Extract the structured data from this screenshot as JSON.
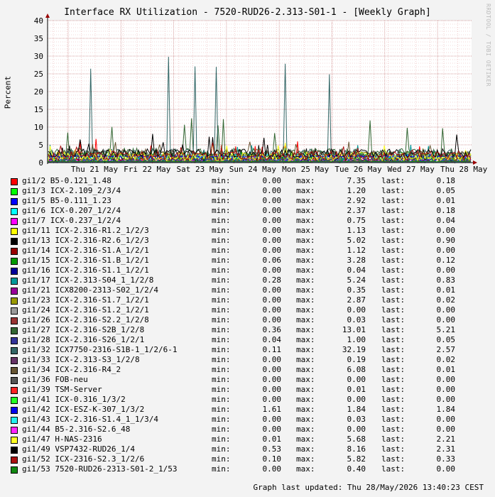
{
  "title": "Interface RX Utilization - 7520-RUD26-2.313-S01-1 - [Weekly Graph]",
  "watermark": "RRDTOOL / TOBI OETIKER",
  "footer": "Graph last updated: Thu 28/May/2026 13:40:23 CEST",
  "colors": {
    "background": "#f3f3f3",
    "plot_bg": "#ffffff",
    "grid_minor": "#e8b0b0",
    "grid_major": "#c88080",
    "axis": "#000000",
    "arrow": "#990000"
  },
  "chart_data": {
    "type": "line",
    "ylabel": "Percent",
    "ylim": [
      0,
      40
    ],
    "yticks": [
      "0",
      "5",
      "10",
      "15",
      "20",
      "25",
      "30",
      "35",
      "40"
    ],
    "xticks": [
      "Thu 21 May",
      "Fri 22 May",
      "Sat 23 May",
      "Sun 24 May",
      "Mon 25 May",
      "Tue 26 May",
      "Wed 27 May",
      "Thu 28 May"
    ],
    "grid": true,
    "legend_position": "bottom",
    "legend_labels": {
      "min": "min:",
      "max": "max:",
      "last": "last:"
    },
    "series": [
      {
        "name": "gi1/2 B5-0.121_1.48",
        "color": "#ff0000",
        "min": "0.00",
        "max": "7.35",
        "last": "0.18"
      },
      {
        "name": "gi1/3 ICX-2.109_2/3/4",
        "color": "#00ff00",
        "min": "0.00",
        "max": "1.20",
        "last": "0.05"
      },
      {
        "name": "gi1/5 B5-0.111_1.23",
        "color": "#0000ff",
        "min": "0.00",
        "max": "2.92",
        "last": "0.01"
      },
      {
        "name": "gi1/6 ICX-0.207_1/2/4",
        "color": "#00ffff",
        "min": "0.00",
        "max": "2.37",
        "last": "0.18"
      },
      {
        "name": "gi1/7 ICX-0.237_1/2/4",
        "color": "#ff00ff",
        "min": "0.00",
        "max": "0.75",
        "last": "0.04"
      },
      {
        "name": "gi1/11 ICX-2.316-R1.2_1/2/3",
        "color": "#ffff00",
        "min": "0.00",
        "max": "1.13",
        "last": "0.00"
      },
      {
        "name": "gi1/13 ICX-2.316-R2.6_1/2/3",
        "color": "#000000",
        "min": "0.00",
        "max": "5.02",
        "last": "0.90"
      },
      {
        "name": "gi1/14 ICX-2.316-S1.A_1/2/1",
        "color": "#990000",
        "min": "0.00",
        "max": "1.12",
        "last": "0.00"
      },
      {
        "name": "gi1/15 ICX-2.316-S1.B_1/2/1",
        "color": "#009900",
        "min": "0.06",
        "max": "3.28",
        "last": "0.12"
      },
      {
        "name": "gi1/16 ICX-2.316-S1.1_1/2/1",
        "color": "#000099",
        "min": "0.00",
        "max": "0.04",
        "last": "0.00"
      },
      {
        "name": "gi1/17 ICX-2.313-S04_1_1/2/8",
        "color": "#009999",
        "min": "0.28",
        "max": "5.24",
        "last": "0.83"
      },
      {
        "name": "gi1/21 ICX8200-2313-S02_1/2/4",
        "color": "#990099",
        "min": "0.00",
        "max": "0.35",
        "last": "0.01"
      },
      {
        "name": "gi1/23 ICX-2.316-S1.7_1/2/1",
        "color": "#999900",
        "min": "0.00",
        "max": "2.87",
        "last": "0.02"
      },
      {
        "name": "gi1/24 ICX-2.316-S1.2_1/2/1",
        "color": "#999999",
        "min": "0.00",
        "max": "0.00",
        "last": "0.00"
      },
      {
        "name": "gi1/26 ICX-2.316-S2.2_1/2/8",
        "color": "#993333",
        "min": "0.00",
        "max": "0.03",
        "last": "0.00"
      },
      {
        "name": "gi1/27 ICX-2.316-S2B_1/2/8",
        "color": "#336633",
        "min": "0.36",
        "max": "13.01",
        "last": "5.21"
      },
      {
        "name": "gi1/28 ICX-2.316-S26_1/2/1",
        "color": "#333399",
        "min": "0.04",
        "max": "1.00",
        "last": "0.05"
      },
      {
        "name": "gi1/32 ICX7750-2316-S1B-1_1/2/6-1",
        "color": "#336666",
        "min": "0.11",
        "max": "32.19",
        "last": "2.57"
      },
      {
        "name": "gi1/33 ICX-2.313-S3_1/2/8",
        "color": "#663366",
        "min": "0.00",
        "max": "0.19",
        "last": "0.02"
      },
      {
        "name": "gi1/34 ICX-2.316-R4_2",
        "color": "#665533",
        "min": "0.00",
        "max": "6.08",
        "last": "0.01"
      },
      {
        "name": "gi1/36 FOB-neu",
        "color": "#555555",
        "min": "0.00",
        "max": "0.00",
        "last": "0.00"
      },
      {
        "name": "gi1/39 TSM-Server",
        "color": "#ff2222",
        "min": "0.00",
        "max": "0.01",
        "last": "0.00"
      },
      {
        "name": "gi1/41 ICX-0.316_1/3/2",
        "color": "#22ff22",
        "min": "0.00",
        "max": "0.00",
        "last": "0.00"
      },
      {
        "name": "gi1/42 ICX-ESZ-K-307_1/3/2",
        "color": "#0000ee",
        "min": "1.61",
        "max": "1.84",
        "last": "1.84"
      },
      {
        "name": "gi1/43 ICX-2.316-S1.4_1_1/3/4",
        "color": "#22eeee",
        "min": "0.00",
        "max": "0.03",
        "last": "0.00"
      },
      {
        "name": "gi1/44 B5-2.316-S2.6_48",
        "color": "#ff22ff",
        "min": "0.00",
        "max": "0.00",
        "last": "0.00"
      },
      {
        "name": "gi1/47 H-NAS-2316",
        "color": "#ffff22",
        "min": "0.01",
        "max": "5.68",
        "last": "2.21"
      },
      {
        "name": "gi1/49 VSP7432-RUD26_1/4",
        "color": "#000000",
        "min": "0.53",
        "max": "8.16",
        "last": "2.31"
      },
      {
        "name": "gi1/52 ICX-2316-S2.3_1/2/6",
        "color": "#aa1111",
        "min": "0.10",
        "max": "5.82",
        "last": "0.33"
      },
      {
        "name": "gi1/53 7520-RUD26-2313-S01-2_1/53",
        "color": "#118811",
        "min": "0.00",
        "max": "0.40",
        "last": "0.00"
      }
    ]
  }
}
